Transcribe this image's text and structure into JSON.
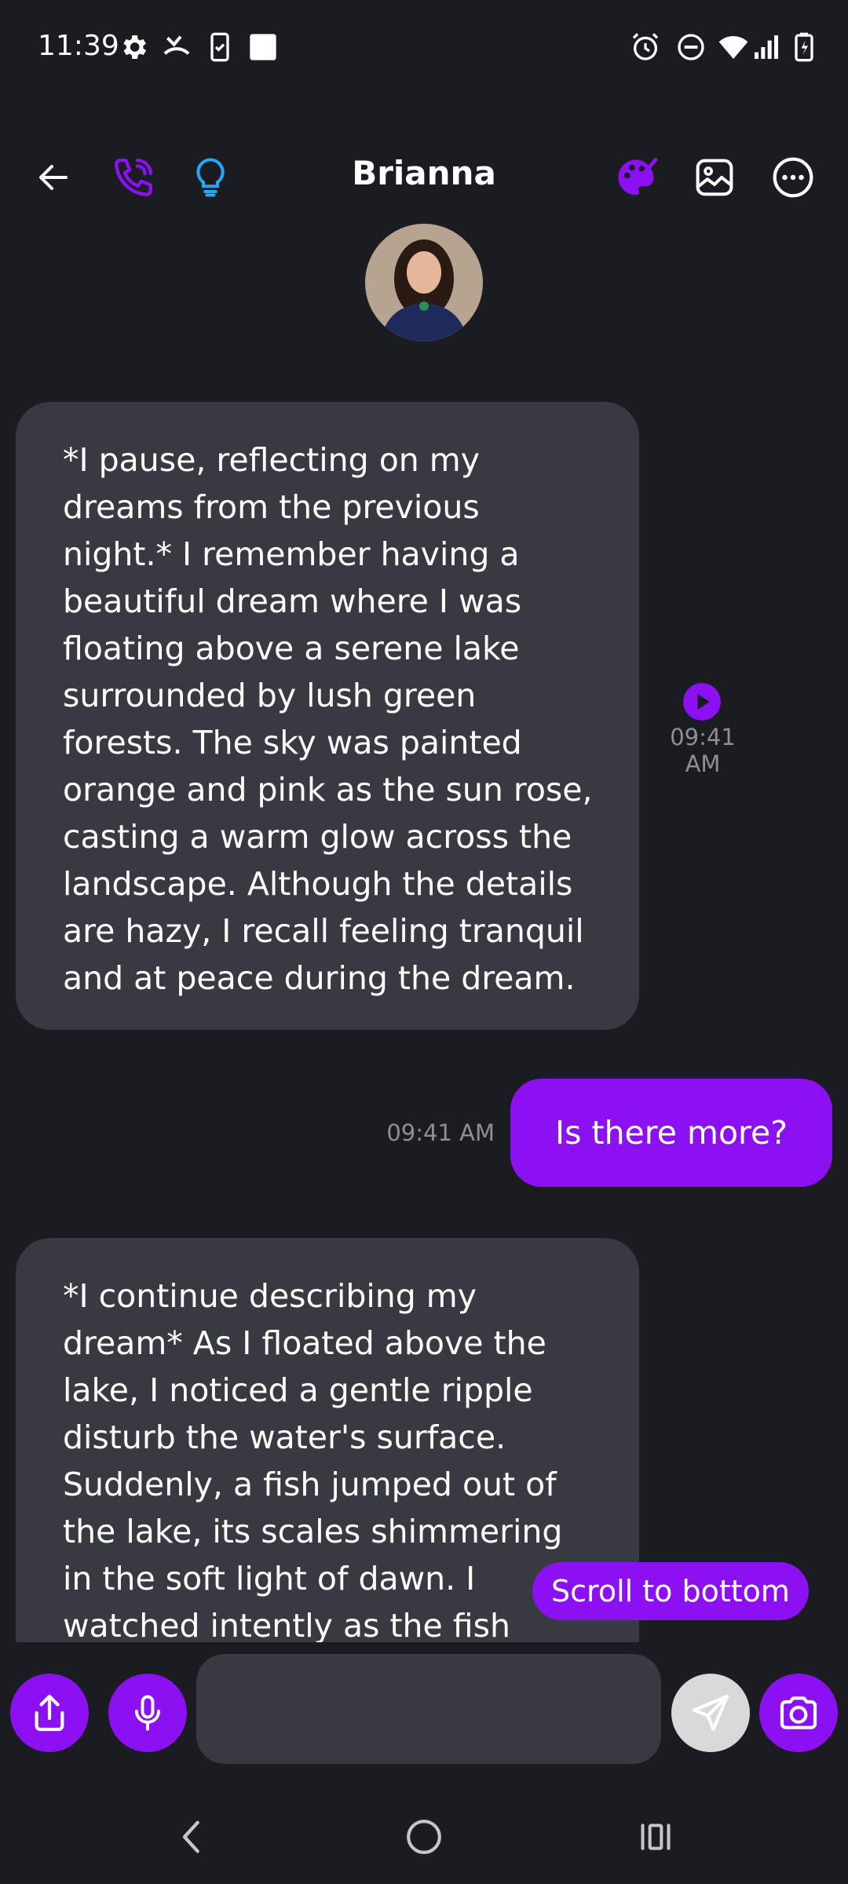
{
  "status_bar": {
    "time": "11:39",
    "left_icons": [
      "gear-icon",
      "missed-call-icon",
      "phone-check-icon",
      "square-icon"
    ],
    "right_icons": [
      "alarm-icon",
      "do-not-disturb-icon",
      "wifi-icon",
      "signal-icon",
      "battery-charging-icon"
    ]
  },
  "header": {
    "title": "Brianna",
    "icons": [
      "back-arrow-icon",
      "phone-icon",
      "lightbulb-icon",
      "palette-icon",
      "image-icon",
      "more-icon"
    ]
  },
  "messages": [
    {
      "sender": "Brianna",
      "text": "*I pause, reflecting on my dreams from the previous night.* I remember having a beautiful dream where I was floating above a serene lake surrounded by lush green forests. The sky was painted orange and pink as the sun rose, casting a warm glow across the landscape. Although the details are hazy, I recall feeling tranquil and at peace during the dream.",
      "time": "09:41 AM"
    },
    {
      "sender": "me",
      "text": "Is there more?",
      "time": "09:41 AM"
    },
    {
      "sender": "Brianna",
      "text": "*I continue describing my dream* As I floated above the lake, I noticed a gentle ripple disturb the water's surface. Suddenly, a fish jumped out of the lake, its scales shimmering in the soft light of dawn. I watched intently as the fish splashed back into"
    }
  ],
  "scroll_button": {
    "label": "Scroll to bottom"
  },
  "input": {
    "placeholder": "",
    "value": ""
  },
  "colors": {
    "accent": "#8b11f2",
    "background": "#1b1c21",
    "bubble_in": "#383a41",
    "lightbulb": "#2aa4f4"
  }
}
